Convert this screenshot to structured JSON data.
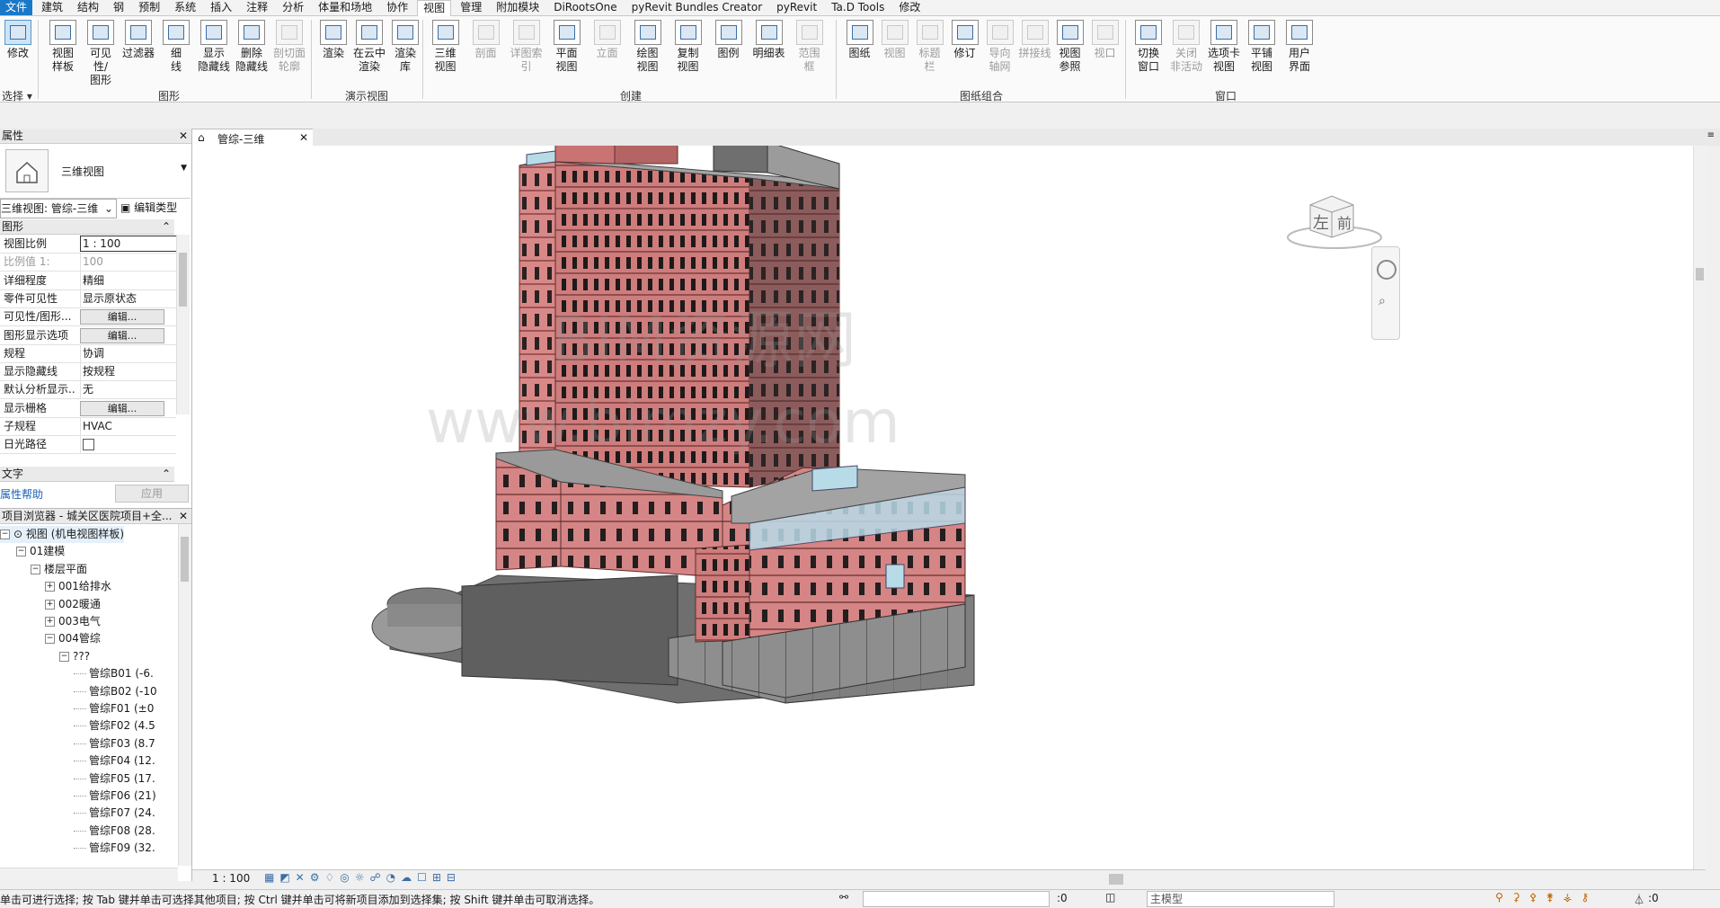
{
  "menu": {
    "tabs": [
      "文件",
      "建筑",
      "结构",
      "钢",
      "预制",
      "系统",
      "插入",
      "注释",
      "分析",
      "体量和场地",
      "协作",
      "视图",
      "管理",
      "附加模块",
      "DiRootsOne",
      "pyRevit Bundles Creator",
      "pyRevit",
      "Ta.D Tools",
      "修改"
    ],
    "active_tab": "视图"
  },
  "ribbon": {
    "select": {
      "label": "修改",
      "group": "选择"
    },
    "graphics": {
      "group": "图形",
      "buttons": [
        {
          "l1": "视图",
          "l2": "样板"
        },
        {
          "l1": "可见性/",
          "l2": "图形"
        },
        {
          "l1": "过滤器",
          "l2": ""
        },
        {
          "l1": "细",
          "l2": "线"
        },
        {
          "l1": "显示",
          "l2": "隐藏线"
        },
        {
          "l1": "删除",
          "l2": "隐藏线"
        },
        {
          "l1": "剖切面",
          "l2": "轮廓"
        }
      ]
    },
    "presentation": {
      "group": "演示视图",
      "buttons": [
        {
          "l1": "渲染",
          "l2": ""
        },
        {
          "l1": "在云中",
          "l2": "渲染"
        },
        {
          "l1": "渲染",
          "l2": "库"
        }
      ]
    },
    "create": {
      "group": "创建",
      "buttons": [
        {
          "l1": "三维",
          "l2": "视图"
        },
        {
          "l1": "剖面",
          "l2": ""
        },
        {
          "l1": "详图索引",
          "l2": ""
        },
        {
          "l1": "平面",
          "l2": "视图"
        },
        {
          "l1": "立面",
          "l2": ""
        },
        {
          "l1": "绘图",
          "l2": "视图"
        },
        {
          "l1": "复制",
          "l2": "视图"
        },
        {
          "l1": "图例",
          "l2": ""
        },
        {
          "l1": "明细表",
          "l2": ""
        },
        {
          "l1": "范围",
          "l2": "框"
        }
      ]
    },
    "sheet": {
      "group": "图纸组合",
      "buttons": [
        {
          "l1": "图纸",
          "l2": ""
        },
        {
          "l1": "视图",
          "l2": ""
        },
        {
          "l1": "标题",
          "l2": "栏"
        },
        {
          "l1": "修订",
          "l2": ""
        },
        {
          "l1": "导向",
          "l2": "轴网"
        },
        {
          "l1": "拼接线",
          "l2": ""
        },
        {
          "l1": "视图",
          "l2": "参照"
        },
        {
          "l1": "视口",
          "l2": ""
        }
      ]
    },
    "window": {
      "group": "窗口",
      "buttons": [
        {
          "l1": "切换",
          "l2": "窗口"
        },
        {
          "l1": "关闭",
          "l2": "非活动"
        },
        {
          "l1": "选项卡",
          "l2": "视图"
        },
        {
          "l1": "平铺",
          "l2": "视图"
        },
        {
          "l1": "用户",
          "l2": "界面"
        }
      ]
    }
  },
  "properties": {
    "title": "属性",
    "type_name": "三维视图",
    "selector": "三维视图: 管综-三维",
    "edit_type": "编辑类型",
    "section_graphics": "图形",
    "rows": [
      {
        "k": "视图比例",
        "v": "1 : 100"
      },
      {
        "k": "比例值 1:",
        "v": "100"
      },
      {
        "k": "详细程度",
        "v": "精细"
      },
      {
        "k": "零件可见性",
        "v": "显示原状态"
      },
      {
        "k": "可见性/图形...",
        "v": "编辑..."
      },
      {
        "k": "图形显示选项",
        "v": "编辑..."
      },
      {
        "k": "规程",
        "v": "协调"
      },
      {
        "k": "显示隐藏线",
        "v": "按规程"
      },
      {
        "k": "默认分析显示...",
        "v": "无"
      },
      {
        "k": "显示栅格",
        "v": "编辑..."
      },
      {
        "k": "子规程",
        "v": "HVAC"
      },
      {
        "k": "日光路径",
        "v": ""
      }
    ],
    "section_text": "文字",
    "help": "属性帮助",
    "apply": "应用"
  },
  "browser": {
    "title": "项目浏览器 - 城关区医院项目+全...",
    "items": [
      {
        "t": "视图 (机电视图样板)",
        "lvl": 0,
        "pm": "-"
      },
      {
        "t": "01建模",
        "lvl": 1,
        "pm": "-"
      },
      {
        "t": "楼层平面",
        "lvl": 2,
        "pm": "-"
      },
      {
        "t": "001给排水",
        "lvl": 3,
        "pm": "+"
      },
      {
        "t": "002暖通",
        "lvl": 3,
        "pm": "+"
      },
      {
        "t": "003电气",
        "lvl": 3,
        "pm": "+"
      },
      {
        "t": "004管综",
        "lvl": 3,
        "pm": "-"
      },
      {
        "t": "???",
        "lvl": 4,
        "pm": "-"
      },
      {
        "t": "管综B01 (-6.",
        "lvl": 5,
        "pm": ""
      },
      {
        "t": "管综B02 (-10",
        "lvl": 5,
        "pm": ""
      },
      {
        "t": "管综F01 (±0",
        "lvl": 5,
        "pm": ""
      },
      {
        "t": "管综F02 (4.5",
        "lvl": 5,
        "pm": ""
      },
      {
        "t": "管综F03 (8.7",
        "lvl": 5,
        "pm": ""
      },
      {
        "t": "管综F04 (12.",
        "lvl": 5,
        "pm": ""
      },
      {
        "t": "管综F05 (17.",
        "lvl": 5,
        "pm": ""
      },
      {
        "t": "管综F06 (21)",
        "lvl": 5,
        "pm": ""
      },
      {
        "t": "管综F07 (24.",
        "lvl": 5,
        "pm": ""
      },
      {
        "t": "管综F08 (28.",
        "lvl": 5,
        "pm": ""
      },
      {
        "t": "管综F09 (32.",
        "lvl": 5,
        "pm": ""
      }
    ]
  },
  "view": {
    "tab": "管综-三维",
    "viewcube_left": "左",
    "viewcube_front": "前",
    "watermark1": "BIM资源网",
    "watermark2": "www.bimzy.com",
    "scale": "1 : 100"
  },
  "status": {
    "hint": "单击可进行选择; 按 Tab 键并单击可选择其他项目; 按 Ctrl 键并单击可将新项目添加到选择集; 按 Shift 键并单击可取消选择。",
    "count0": ":0",
    "model": "主模型",
    "filter": ":0"
  },
  "colors": {
    "accent": "#1979c8",
    "facade": "#d98888",
    "facade_dark": "#a95a5a",
    "glass": "#b8dbe8",
    "podium_gray": "#8c8c8c"
  }
}
